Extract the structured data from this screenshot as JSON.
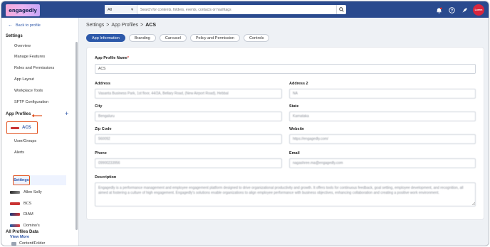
{
  "topbar": {
    "logo_text": "engagedly",
    "search_scope": "All",
    "search_placeholder": "Search for contents, folders, events, contacts or hashtags",
    "avatar_text": "Lorem",
    "icons": [
      "bell-icon",
      "help-icon",
      "rocket-icon",
      "avatar"
    ]
  },
  "sidebar": {
    "back_label": "Back to profile",
    "settings_heading": "Settings",
    "settings_items": [
      "Overview",
      "Manage Features",
      "Roles and Permissions",
      "App Layout",
      "Workplace Tools",
      "SFTP Configuration"
    ],
    "app_profiles_heading": "App Profiles",
    "selected_profile": "ACS",
    "profile_subitems": [
      "User/Groups",
      "Alerts",
      "Settings"
    ],
    "other_profiles": [
      "Allen Solly",
      "BCS",
      "DIAM",
      "Domino's"
    ],
    "view_more": "View More",
    "all_profiles_heading": "All Profiles Data",
    "all_profiles_items": [
      "Content/Folder"
    ]
  },
  "breadcrumb": [
    "Settings",
    "App Profiles",
    "ACS"
  ],
  "tabs": [
    {
      "label": "App Information",
      "active": true
    },
    {
      "label": "Branding",
      "active": false
    },
    {
      "label": "Carousel",
      "active": false
    },
    {
      "label": "Policy and Permission",
      "active": false
    },
    {
      "label": "Controls",
      "active": false
    }
  ],
  "form": {
    "app_profile_name": {
      "label": "App Profile Name",
      "value": "ACS"
    },
    "address": {
      "label": "Address",
      "value": "Vasanta Business Park, 1st floor, 44/2A, Bellary Road, (New Airport Road), Hebbal"
    },
    "address2": {
      "label": "Address 2",
      "value": "NA"
    },
    "city": {
      "label": "City",
      "value": "Bengaluru"
    },
    "state": {
      "label": "State",
      "value": "Karnataka"
    },
    "zip": {
      "label": "Zip Code",
      "value": "560092"
    },
    "website": {
      "label": "Website",
      "value": "https://engagedly.com/"
    },
    "phone": {
      "label": "Phone",
      "value": "09900233956"
    },
    "email": {
      "label": "Email",
      "value": "nagashree.ma@engagedly.com"
    },
    "description": {
      "label": "Description",
      "value": "Engagedly is a performance management and employee engagement platform designed to drive organizational productivity and growth. It offers tools for continuous feedback, goal setting, employee development, and recognition, all aimed at fostering a culture of high engagement. Engagedly's solutions enable organizations to align employee performance with business objectives, enhancing collaboration and creating a positive work environment."
    }
  },
  "colors": {
    "topbar": "#2a4a8e",
    "accent": "#2c58a9",
    "highlight_box": "#e2521f",
    "required_star": "#e0302b"
  }
}
